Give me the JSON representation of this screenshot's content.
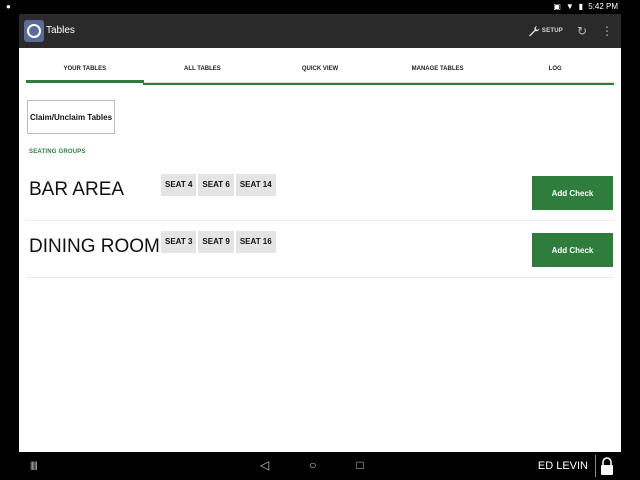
{
  "status_bar": {
    "left_icon": "notification-icon",
    "time": "5:42 PM"
  },
  "app_header": {
    "title": "Tables",
    "setup_label": "SETUP"
  },
  "tabs": [
    {
      "label": "YOUR TABLES",
      "active": true
    },
    {
      "label": "ALL TABLES",
      "active": false
    },
    {
      "label": "QUICK VIEW",
      "active": false
    },
    {
      "label": "MANAGE TABLES",
      "active": false
    },
    {
      "label": "LOG",
      "active": false
    }
  ],
  "claim_button_label": "Claim/Unclaim Tables",
  "section_label": "SEATING GROUPS",
  "groups": [
    {
      "name": "BAR AREA",
      "seats": [
        "SEAT 4",
        "SEAT 6",
        "SEAT 14"
      ],
      "action_label": "Add Check"
    },
    {
      "name": "DINING ROOM",
      "seats": [
        "SEAT 3",
        "SEAT 9",
        "SEAT 16"
      ],
      "action_label": "Add Check"
    }
  ],
  "nav_bar": {
    "user_name": "ED LEVIN"
  },
  "colors": {
    "accent_green": "#2f7d3c",
    "header_bg": "#2a2a2a"
  }
}
